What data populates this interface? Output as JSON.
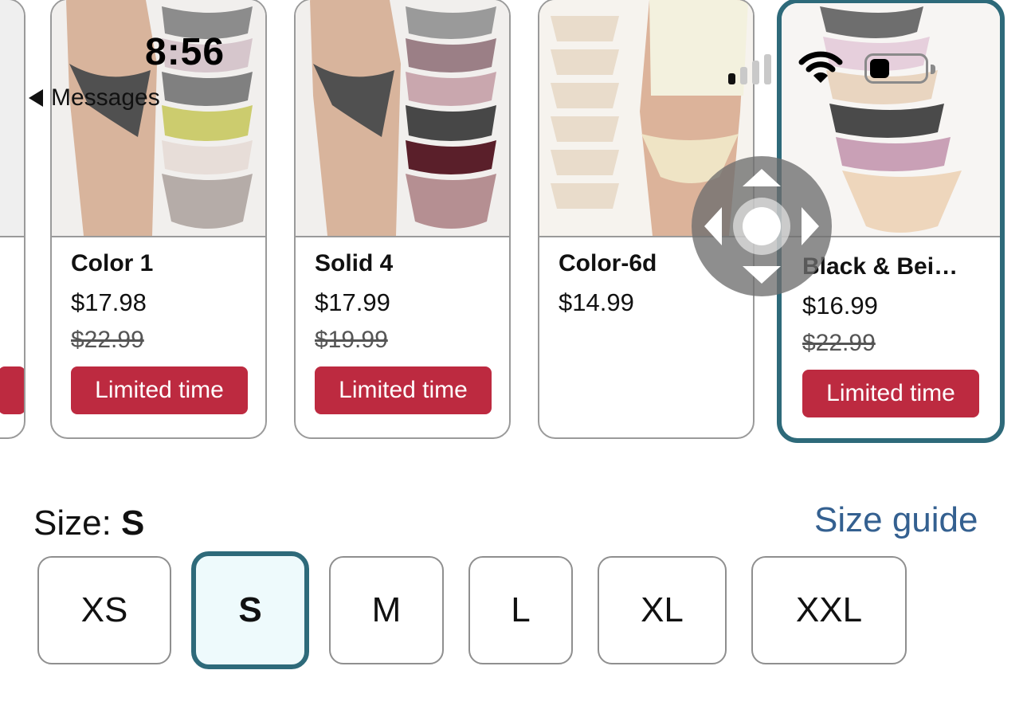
{
  "status_bar": {
    "time": "8:56",
    "back_label": "Messages"
  },
  "products": [
    {
      "name": "Color 1",
      "price": "$17.98",
      "old_price": "$22.99",
      "badge": "Limited time"
    },
    {
      "name": "Solid 4",
      "price": "$17.99",
      "old_price": "$19.99",
      "badge": "Limited time"
    },
    {
      "name": "Color-6d",
      "price": "$14.99"
    },
    {
      "name": "Black & Bei…",
      "price": "$16.99",
      "old_price": "$22.99",
      "badge": "Limited time"
    }
  ],
  "size": {
    "label": "Size: ",
    "selected": "S",
    "guide_link": "Size guide",
    "options": [
      "XS",
      "S",
      "M",
      "L",
      "XL",
      "XXL"
    ]
  },
  "colors": {
    "accent": "#2e6a7a",
    "badge": "#bd2a40",
    "link": "#346090"
  }
}
